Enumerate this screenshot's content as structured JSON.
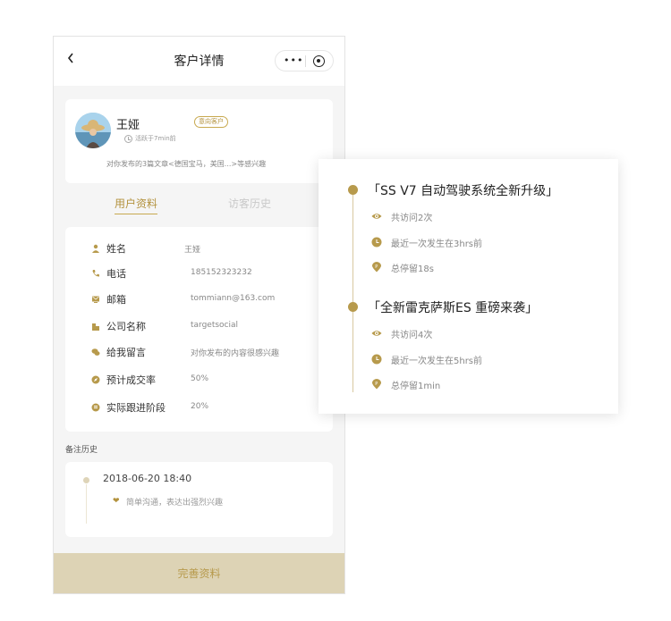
{
  "nav": {
    "title": "客户详情",
    "menu_dots": "•••"
  },
  "profile": {
    "name": "王娅",
    "badge": "意向客户",
    "active_time": "活跃于7min前",
    "description": "对你发布的3篇文章<德国宝马，美国...>等感兴趣"
  },
  "tabs": [
    {
      "label": "用户资料"
    },
    {
      "label": "访客历史"
    }
  ],
  "info": [
    {
      "icon": "person-icon",
      "label": "姓名",
      "value": "王娅"
    },
    {
      "icon": "phone-icon",
      "label": "电话",
      "value": "185152323232"
    },
    {
      "icon": "mail-icon",
      "label": "邮箱",
      "value": "tommiann@163.com"
    },
    {
      "icon": "building-icon",
      "label": "公司名称",
      "value": "targetsocial"
    },
    {
      "icon": "chat-icon",
      "label": "给我留言",
      "value": "对你发布的内容很感兴趣"
    },
    {
      "icon": "compass-icon",
      "label": "预计成交率",
      "value": "50%"
    },
    {
      "icon": "stage-icon",
      "label": "实际跟进阶段",
      "value": "20%"
    }
  ],
  "remarks": {
    "title": "备注历史",
    "items": [
      {
        "date": "2018-06-20 18:40",
        "note": "简单沟通，表达出强烈兴趣"
      }
    ]
  },
  "footer": {
    "button_label": "完善资料"
  },
  "history": [
    {
      "title": "「SS V7 自动驾驶系统全新升级」",
      "visits": "共访问2次",
      "last": "最近一次发生在3hrs前",
      "stay": "总停留18s"
    },
    {
      "title": "「全新雷克萨斯ES 重磅来袭」",
      "visits": "共访问4次",
      "last": "最近一次发生在5hrs前",
      "stay": "总停留1min"
    }
  ],
  "colors": {
    "accent": "#b79a4c",
    "footer_bg": "#ddd3b5",
    "page_bg": "#f5f5f5"
  }
}
